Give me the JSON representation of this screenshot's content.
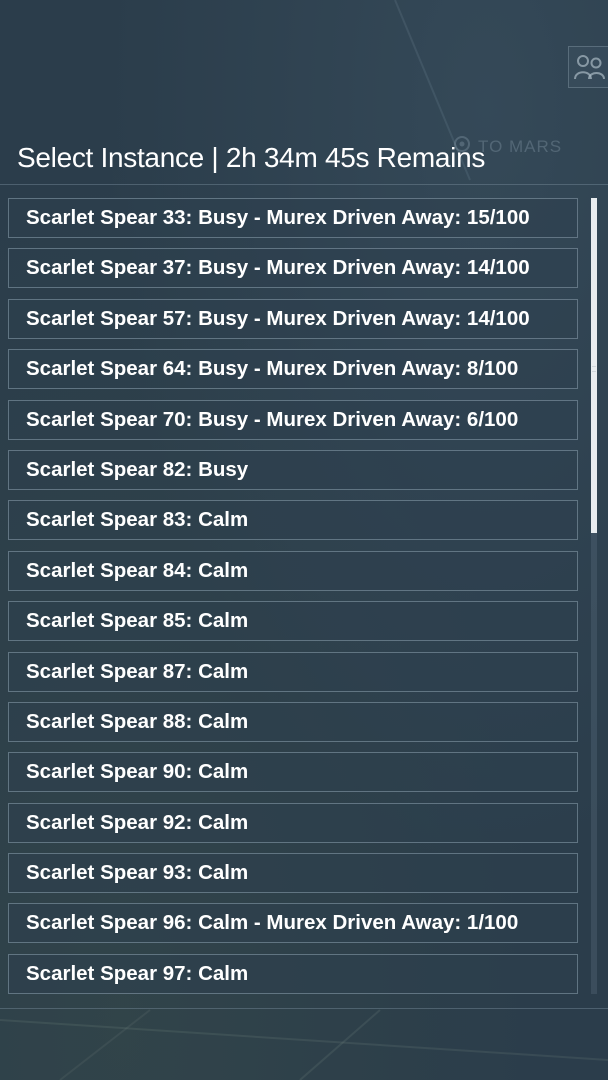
{
  "header": {
    "title": "Select Instance | 2h 34m 45s Remains"
  },
  "background": {
    "watermark_text": "TO MARS"
  },
  "corner": {
    "icon": "players-icon"
  },
  "instances": [
    {
      "label": "Scarlet Spear 33: Busy - Murex Driven Away: 15/100"
    },
    {
      "label": "Scarlet Spear 37: Busy - Murex Driven Away: 14/100"
    },
    {
      "label": "Scarlet Spear 57: Busy - Murex Driven Away: 14/100"
    },
    {
      "label": "Scarlet Spear 64: Busy - Murex Driven Away: 8/100"
    },
    {
      "label": "Scarlet Spear 70: Busy - Murex Driven Away: 6/100"
    },
    {
      "label": "Scarlet Spear 82: Busy"
    },
    {
      "label": "Scarlet Spear 83: Calm"
    },
    {
      "label": "Scarlet Spear 84: Calm"
    },
    {
      "label": "Scarlet Spear 85: Calm"
    },
    {
      "label": "Scarlet Spear 87: Calm"
    },
    {
      "label": "Scarlet Spear 88: Calm"
    },
    {
      "label": "Scarlet Spear 90: Calm"
    },
    {
      "label": "Scarlet Spear 92: Calm"
    },
    {
      "label": "Scarlet Spear 93: Calm"
    },
    {
      "label": "Scarlet Spear 96: Calm - Murex Driven Away: 1/100"
    },
    {
      "label": "Scarlet Spear 97: Calm"
    }
  ],
  "colors": {
    "background": "#2b3d4b",
    "text": "#ffffff",
    "row_border": "#8ca0af",
    "scroll_thumb": "#e8ecef"
  }
}
